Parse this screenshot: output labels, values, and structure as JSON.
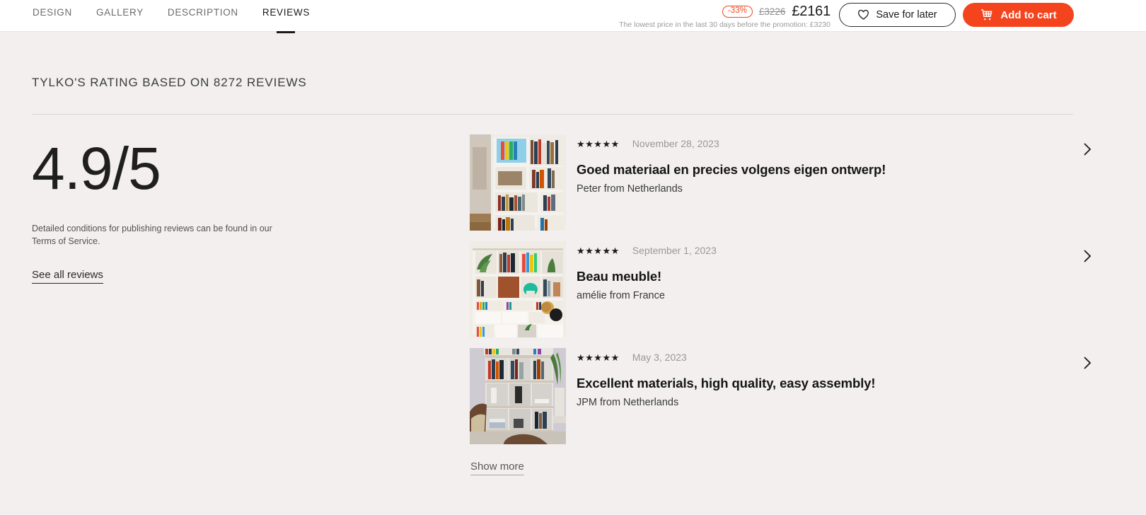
{
  "nav": {
    "items": [
      {
        "label": "DESIGN",
        "active": false
      },
      {
        "label": "GALLERY",
        "active": false
      },
      {
        "label": "DESCRIPTION",
        "active": false
      },
      {
        "label": "REVIEWS",
        "active": true
      }
    ]
  },
  "pricing": {
    "discount_badge": "-33%",
    "old_price": "£3226",
    "current_price": "£2161",
    "lowest_price_note": "The lowest price in the last 30 days before the promotion: £3230",
    "accent_color": "#f4441d"
  },
  "actions": {
    "save_label": "Save for later",
    "save_icon": "heart-icon",
    "cart_label": "Add to cart",
    "cart_icon": "shopping-cart-icon"
  },
  "reviews_section": {
    "heading": "TYLKO'S RATING BASED ON 8272 REVIEWS",
    "rating_value": "4.9/5",
    "rating_note": "Detailed conditions for publishing reviews can be found in our Terms of Service.",
    "see_all_label": "See all reviews",
    "show_more_label": "Show more",
    "items": [
      {
        "stars": "★★★★★",
        "rating": 5,
        "date": "November 28, 2023",
        "title": "Goed materiaal en precies volgens eigen ontwerp!",
        "author": "Peter from Netherlands",
        "thumbnail_alt": "white-bookshelf-with-books-photo"
      },
      {
        "stars": "★★★★★",
        "rating": 5,
        "date": "September 1, 2023",
        "title": "Beau meuble!",
        "author": "amélie from France",
        "thumbnail_alt": "large-white-shelving-unit-with-plants-photo"
      },
      {
        "stars": "★★★★★",
        "rating": 5,
        "date": "May 3, 2023",
        "title": "Excellent materials, high quality, easy assembly!",
        "author": "JPM from Netherlands",
        "thumbnail_alt": "grey-bookcase-with-armchair-photo"
      }
    ]
  }
}
